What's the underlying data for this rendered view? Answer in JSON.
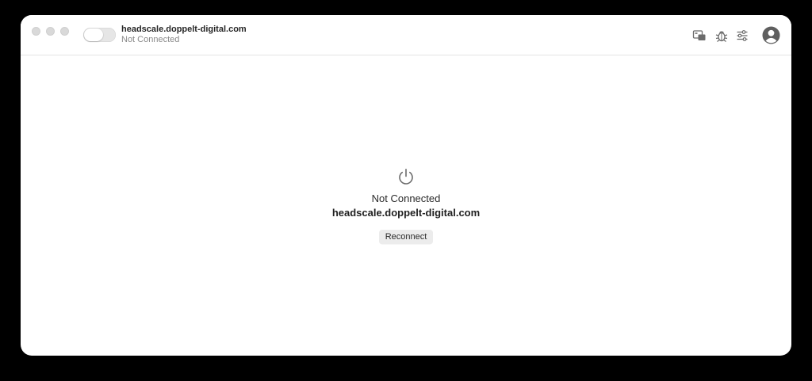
{
  "titlebar": {
    "host": "headscale.doppelt-digital.com",
    "status": "Not Connected",
    "toggle_on": false,
    "icons": [
      "exit-node-icon",
      "bug-icon",
      "settings-sliders-icon",
      "account-avatar-icon"
    ]
  },
  "main": {
    "status": "Not Connected",
    "host": "headscale.doppelt-digital.com",
    "reconnect_label": "Reconnect",
    "icon": "power-icon"
  },
  "colors": {
    "window_bg": "#ffffff",
    "outer_bg": "#000000",
    "icon_gray": "#6b6b6b",
    "button_bg": "#ececec"
  }
}
